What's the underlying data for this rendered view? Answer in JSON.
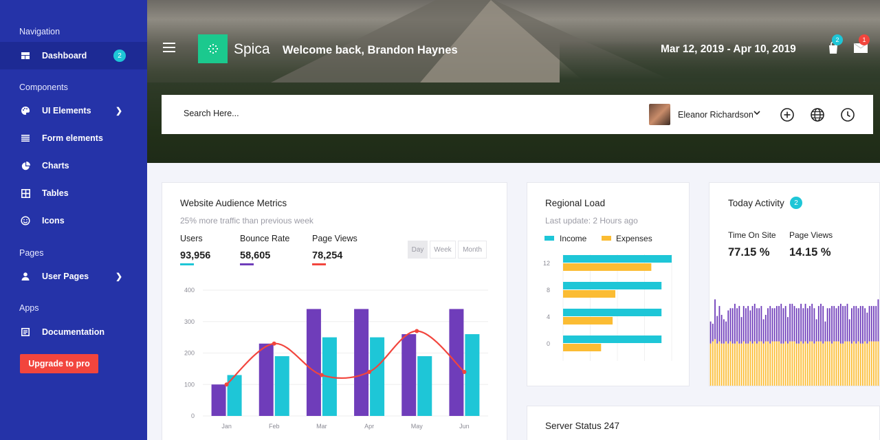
{
  "sidebar": {
    "sections": {
      "navigation": "Navigation",
      "components": "Components",
      "pages": "Pages",
      "apps": "Apps"
    },
    "items": {
      "dashboard": {
        "label": "Dashboard",
        "badge": "2"
      },
      "ui_elements": {
        "label": "UI Elements"
      },
      "form_elements": {
        "label": "Form elements"
      },
      "charts": {
        "label": "Charts"
      },
      "tables": {
        "label": "Tables"
      },
      "icons": {
        "label": "Icons"
      },
      "user_pages": {
        "label": "User Pages"
      },
      "documentation": {
        "label": "Documentation"
      }
    },
    "upgrade_label": "Upgrade to pro"
  },
  "header": {
    "brand": "Spica",
    "welcome": "Welcome back, Brandon Haynes",
    "date_range": "Mar 12, 2019 - Apr 10, 2019",
    "cart_badge": "2",
    "mail_badge": "1"
  },
  "search": {
    "placeholder": "Search Here...",
    "user_name": "Eleanor Richardson"
  },
  "audience": {
    "title": "Website Audience Metrics",
    "subtitle": "25% more traffic than previous week",
    "metrics": [
      {
        "label": "Users",
        "value": "93,956",
        "color": "#1ec6d7"
      },
      {
        "label": "Bounce Rate",
        "value": "58,605",
        "color": "#6f3dba"
      },
      {
        "label": "Page Views",
        "value": "78,254",
        "color": "#f2453d"
      }
    ],
    "ranges": [
      "Day",
      "Week",
      "Month"
    ]
  },
  "regional": {
    "title": "Regional Load",
    "subtitle": "Last update: 2 Hours ago",
    "legend": [
      "Income",
      "Expenses"
    ]
  },
  "activity": {
    "title": "Today Activity",
    "badge": "2",
    "time_label": "Time On Site",
    "time_value": "77.15 %",
    "pv_label": "Page Views",
    "pv_value": "14.15 %",
    "bars_top": [
      0.58,
      0.56,
      0.78,
      0.63,
      0.72,
      0.64,
      0.6,
      0.58,
      0.68,
      0.7,
      0.7,
      0.74,
      0.7,
      0.72,
      0.62,
      0.72,
      0.7,
      0.72,
      0.68,
      0.72,
      0.74,
      0.7,
      0.7,
      0.72,
      0.6,
      0.64,
      0.7,
      0.72,
      0.7,
      0.7,
      0.72,
      0.72,
      0.74,
      0.7,
      0.72,
      0.62,
      0.74,
      0.74,
      0.72,
      0.7,
      0.7,
      0.74,
      0.7,
      0.74,
      0.7,
      0.72,
      0.74,
      0.7,
      0.6,
      0.72,
      0.74,
      0.72,
      0.58,
      0.7,
      0.7,
      0.72,
      0.72,
      0.7,
      0.72,
      0.74,
      0.72,
      0.72,
      0.74,
      0.6,
      0.7,
      0.72,
      0.72,
      0.7,
      0.72,
      0.72,
      0.7,
      0.66,
      0.72,
      0.72,
      0.72,
      0.72,
      0.78
    ],
    "bars_bottom": [
      0.38,
      0.4,
      0.42,
      0.38,
      0.4,
      0.38,
      0.38,
      0.4,
      0.38,
      0.4,
      0.38,
      0.38,
      0.4,
      0.38,
      0.38,
      0.4,
      0.38,
      0.38,
      0.4,
      0.38,
      0.4,
      0.38,
      0.4,
      0.4,
      0.38,
      0.4,
      0.4,
      0.38,
      0.4,
      0.4,
      0.4,
      0.4,
      0.38,
      0.38,
      0.4,
      0.38,
      0.4,
      0.4,
      0.4,
      0.38,
      0.38,
      0.4,
      0.38,
      0.4,
      0.38,
      0.4,
      0.4,
      0.38,
      0.4,
      0.4,
      0.4,
      0.38,
      0.4,
      0.4,
      0.4,
      0.38,
      0.4,
      0.4,
      0.4,
      0.38,
      0.38,
      0.4,
      0.4,
      0.4,
      0.38,
      0.4,
      0.38,
      0.4,
      0.38,
      0.38,
      0.4,
      0.38,
      0.4,
      0.4,
      0.4,
      0.4,
      0.4
    ]
  },
  "server": {
    "title": "Server Status 247"
  },
  "chart_data": [
    {
      "type": "bar",
      "categories": [
        "Jan",
        "Feb",
        "Mar",
        "Apr",
        "May",
        "Jun"
      ],
      "series": [
        {
          "values": [
            100,
            230,
            340,
            340,
            260,
            340
          ],
          "color": "#6f3dba"
        },
        {
          "values": [
            130,
            190,
            250,
            250,
            190,
            260
          ],
          "color": "#1ec6d7"
        },
        {
          "values": [
            100,
            230,
            130,
            140,
            270,
            140
          ],
          "color": "#f2453d",
          "kind": "line"
        }
      ],
      "yticks": [
        0,
        100,
        200,
        300,
        400
      ],
      "ylim": [
        0,
        400
      ]
    },
    {
      "type": "bar",
      "orientation": "horizontal",
      "categories": [
        "12",
        "8",
        "4",
        "0"
      ],
      "series": [
        {
          "name": "Income",
          "values": [
            16,
            14.5,
            14.5,
            14.5
          ],
          "color": "#1ec6d7"
        },
        {
          "name": "Expenses",
          "values": [
            13,
            7.7,
            7.3,
            5.6
          ],
          "color": "#fbbc33"
        }
      ],
      "xlim": [
        0,
        16
      ]
    }
  ]
}
